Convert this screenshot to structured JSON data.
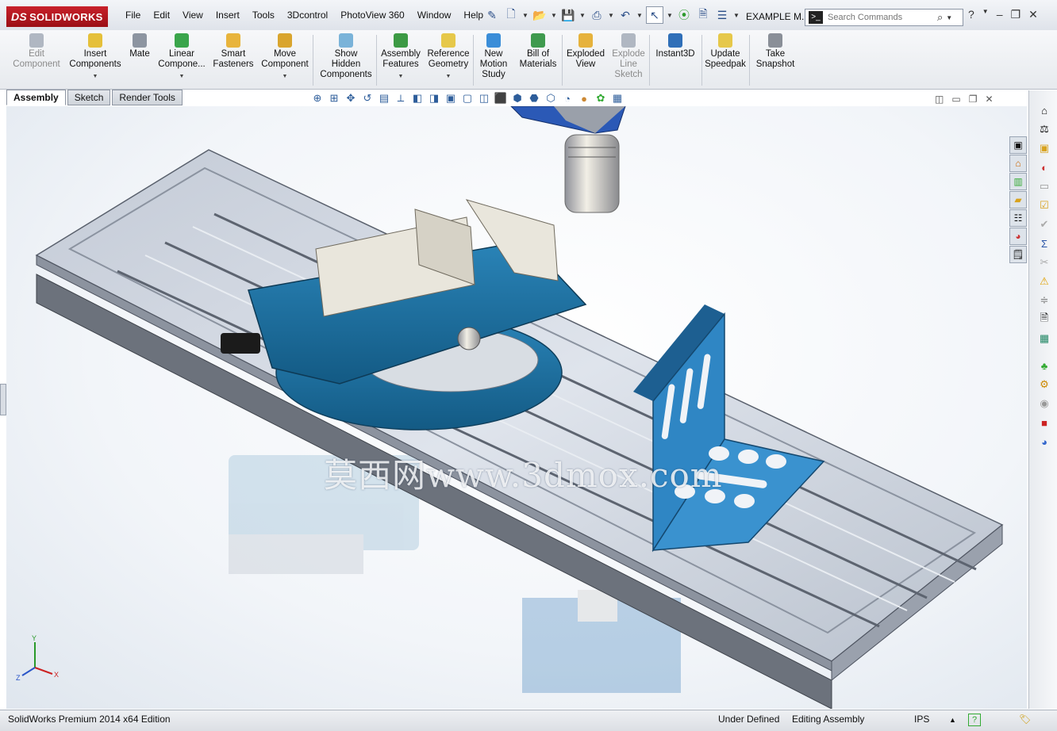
{
  "app": {
    "logo": "SOLIDWORKS",
    "document_title": "EXAMPLE M..."
  },
  "menu": [
    "File",
    "Edit",
    "View",
    "Insert",
    "Tools",
    "3Dcontrol",
    "PhotoView 360",
    "Window",
    "Help"
  ],
  "search": {
    "placeholder": "Search Commands"
  },
  "commands": [
    {
      "label": "Edit Component",
      "lines": [
        "Edit",
        "Component"
      ],
      "disabled": true
    },
    {
      "label": "Insert Components",
      "lines": [
        "Insert",
        "Components"
      ]
    },
    {
      "label": "Mate",
      "lines": [
        "Mate"
      ]
    },
    {
      "label": "Linear Compone...",
      "lines": [
        "Linear",
        "Compone..."
      ]
    },
    {
      "label": "Smart Fasteners",
      "lines": [
        "Smart",
        "Fasteners"
      ]
    },
    {
      "label": "Move Component",
      "lines": [
        "Move",
        "Component"
      ]
    },
    {
      "label": "Show Hidden Components",
      "lines": [
        "Show",
        "Hidden",
        "Components"
      ]
    },
    {
      "label": "Assembly Features",
      "lines": [
        "Assembly",
        "Features"
      ]
    },
    {
      "label": "Reference Geometry",
      "lines": [
        "Reference",
        "Geometry"
      ]
    },
    {
      "label": "New Motion Study",
      "lines": [
        "New",
        "Motion",
        "Study"
      ]
    },
    {
      "label": "Bill of Materials",
      "lines": [
        "Bill of",
        "Materials"
      ]
    },
    {
      "label": "Exploded View",
      "lines": [
        "Exploded",
        "View"
      ]
    },
    {
      "label": "Explode Line Sketch",
      "lines": [
        "Explode",
        "Line",
        "Sketch"
      ],
      "disabled": true
    },
    {
      "label": "Instant3D",
      "lines": [
        "Instant3D"
      ]
    },
    {
      "label": "Update Speedpak",
      "lines": [
        "Update",
        "Speedpak"
      ]
    },
    {
      "label": "Take Snapshot",
      "lines": [
        "Take",
        "Snapshot"
      ]
    }
  ],
  "tabs": [
    "Assembly",
    "Sketch",
    "Render Tools"
  ],
  "watermark": "莫西网www.3dmox.com",
  "status": {
    "product": "SolidWorks Premium 2014 x64 Edition",
    "definition": "Under Defined",
    "mode": "Editing Assembly",
    "units": "IPS"
  },
  "triad": {
    "x": "X",
    "y": "Y",
    "z": "Z"
  },
  "colors": {
    "accent": "#1f6fa3",
    "logo_red": "#b5141d",
    "vise_blue": "#1c6d9c",
    "angle_blue": "#2f86c4"
  }
}
